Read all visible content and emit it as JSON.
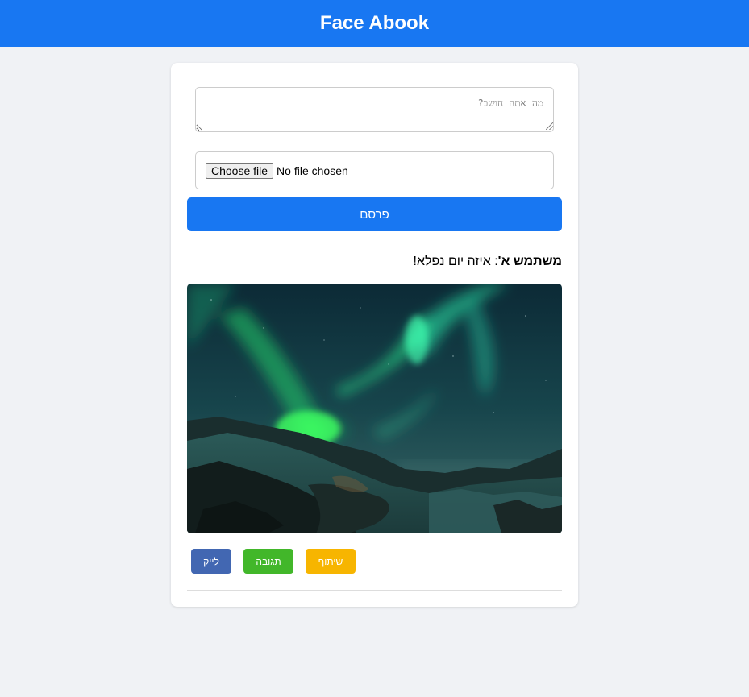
{
  "app": {
    "title": "Face Abook",
    "brand_color": "#1877f2",
    "background_color": "#f0f2f5"
  },
  "composer": {
    "text_placeholder": "מה אתה חושב?",
    "text_value": "",
    "file_button_label": "Choose file",
    "file_status": "No file chosen",
    "publish_label": "פרסם"
  },
  "post": {
    "author": "משתמש א'",
    "separator": ":",
    "text": " איזה יום נפלא!",
    "image_icon": "aurora-photo",
    "actions": {
      "like_label": "לייק",
      "like_color": "#4267b2",
      "comment_label": "תגובה",
      "comment_color": "#42b72a",
      "share_label": "שיתוף",
      "share_color": "#f7b500"
    }
  }
}
